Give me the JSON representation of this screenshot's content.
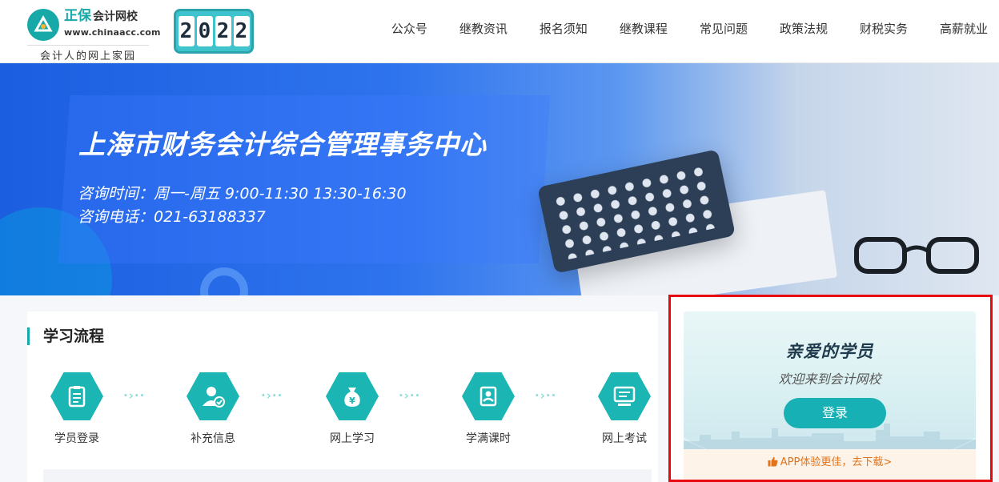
{
  "header": {
    "logo": {
      "brand": "正保",
      "brand_sub": "会计网校",
      "url": "www.chinaacc.com",
      "slogan": "会计人的网上家园"
    },
    "year_digits": [
      "2",
      "0",
      "2",
      "2"
    ],
    "nav": [
      "公众号",
      "继教资讯",
      "报名须知",
      "继教课程",
      "常见问题",
      "政策法规",
      "财税实务",
      "高薪就业"
    ]
  },
  "banner": {
    "title": "上海市财务会计综合管理事务中心",
    "hours": "咨询时间：周一-周五   9:00-11:30   13:30-16:30",
    "phone": "咨询电话：021-63188337"
  },
  "study_flow": {
    "title": "学习流程",
    "steps": [
      {
        "label": "学员登录",
        "icon": "clipboard-icon"
      },
      {
        "label": "补充信息",
        "icon": "user-check-icon"
      },
      {
        "label": "网上学习",
        "icon": "money-bag-icon"
      },
      {
        "label": "学满课时",
        "icon": "certificate-icon"
      },
      {
        "label": "网上考试",
        "icon": "monitor-icon"
      }
    ],
    "arrow_text": "·›··"
  },
  "login": {
    "greeting": "亲爱的学员",
    "welcome": "欢迎来到会计网校",
    "button": "登录",
    "app_promo": "APP体验更佳，去下载>"
  },
  "colors": {
    "accent": "#16a9a7",
    "highlight_border": "#e8070f",
    "promo_text": "#e2731b"
  }
}
